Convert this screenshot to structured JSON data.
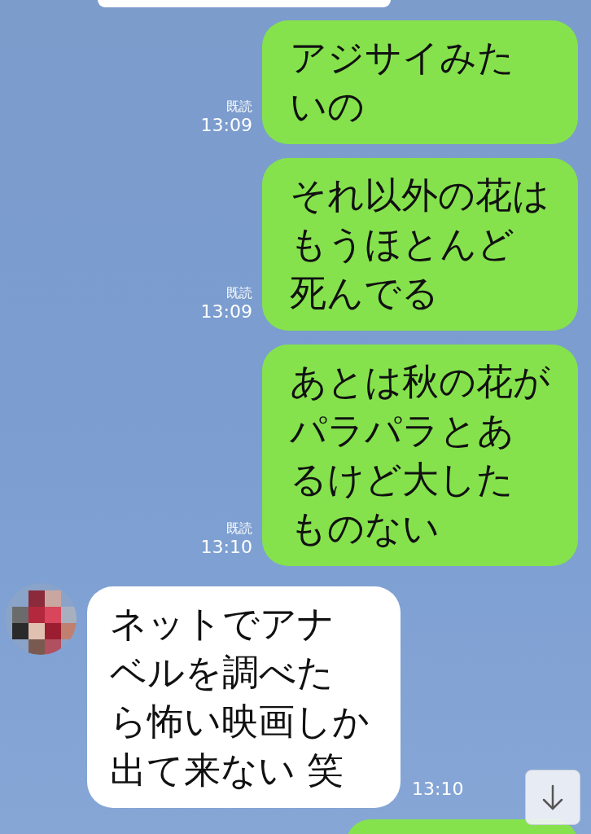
{
  "messages": [
    {
      "kind": "sent",
      "text": "アジサイみたいの",
      "read": "既読",
      "time": "13:09"
    },
    {
      "kind": "sent",
      "text": "それ以外の花はもうほとんど死んでる",
      "read": "既読",
      "time": "13:09"
    },
    {
      "kind": "sent",
      "text": "あとは秋の花がパラパラとあるけど大したものない",
      "read": "既読",
      "time": "13:10"
    },
    {
      "kind": "received",
      "text": "ネットでアナベルを調べたら怖い映画しか出て来ない 笑",
      "time": "13:10"
    }
  ]
}
